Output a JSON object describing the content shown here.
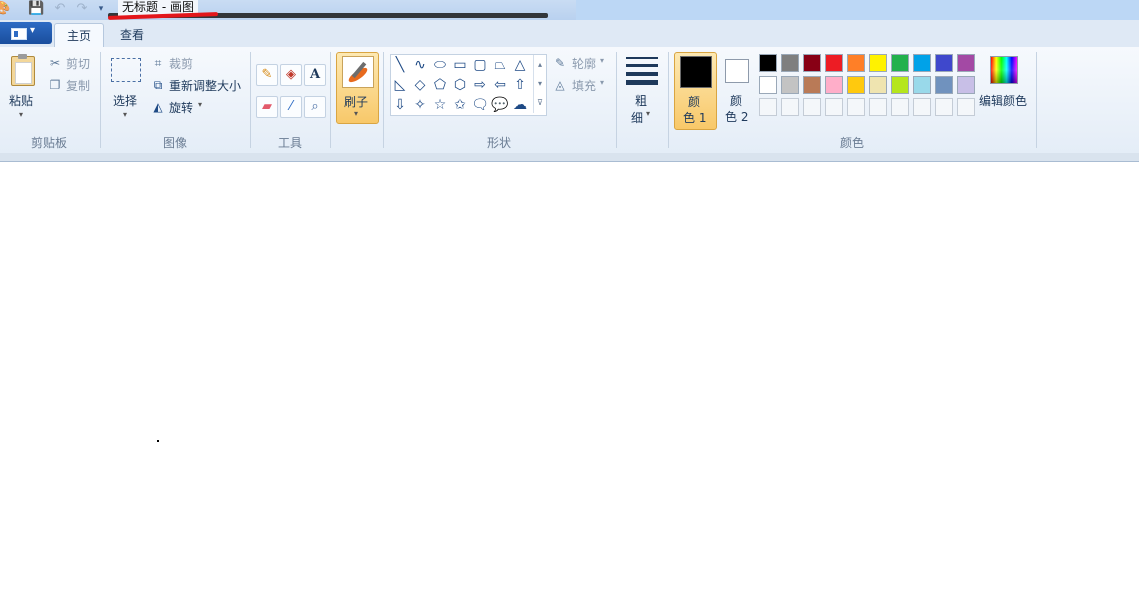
{
  "titlebar": {
    "title": "无标题 - 画图",
    "icons": [
      "paint-app-icon",
      "save-icon",
      "undo-icon",
      "redo-icon",
      "customize-dropdown-icon"
    ]
  },
  "tabs": [
    {
      "label": "主页",
      "active": true
    },
    {
      "label": "查看",
      "active": false
    }
  ],
  "clipboard": {
    "paste_label": "粘贴",
    "cut_label": "剪切",
    "copy_label": "复制",
    "group_label": "剪贴板"
  },
  "image": {
    "select_label": "选择",
    "crop_label": "裁剪",
    "resize_label": "重新调整大小",
    "rotate_label": "旋转",
    "group_label": "图像"
  },
  "tools": {
    "group_label": "工具",
    "text_glyph": "A"
  },
  "brushes": {
    "label": "刷子"
  },
  "shapes": {
    "outline_label": "轮廓",
    "fill_label": "填充",
    "group_label": "形状",
    "row1": [
      "╲",
      "∿",
      "⬭",
      "▭",
      "▢",
      "⏢",
      "△"
    ],
    "row2": [
      "◺",
      "◇",
      "⬠",
      "⬡",
      "⇨",
      "⇦",
      "⇧"
    ],
    "row3": [
      "⇩",
      "✧",
      "☆",
      "✩",
      "🗨",
      "💬",
      "☁"
    ]
  },
  "size": {
    "label_line1": "粗",
    "label_line2": "细"
  },
  "colors": {
    "color1_line1": "颜",
    "color1_line2": "色 1",
    "color2_line1": "颜",
    "color2_line2": "色 2",
    "color1_value": "#000000",
    "color2_value": "#ffffff",
    "edit_colors_label": "编辑颜色",
    "group_label": "颜色",
    "palette_row1": [
      "#000000",
      "#7f7f7f",
      "#880015",
      "#ed1c24",
      "#ff7f27",
      "#fff200",
      "#22b14c",
      "#00a2e8",
      "#3f48cc",
      "#a349a4"
    ],
    "palette_row2": [
      "#ffffff",
      "#c3c3c3",
      "#b97a57",
      "#ffaec9",
      "#ffc90e",
      "#efe4b0",
      "#b5e61d",
      "#99d9ea",
      "#7092be",
      "#c8bfe7"
    ]
  }
}
